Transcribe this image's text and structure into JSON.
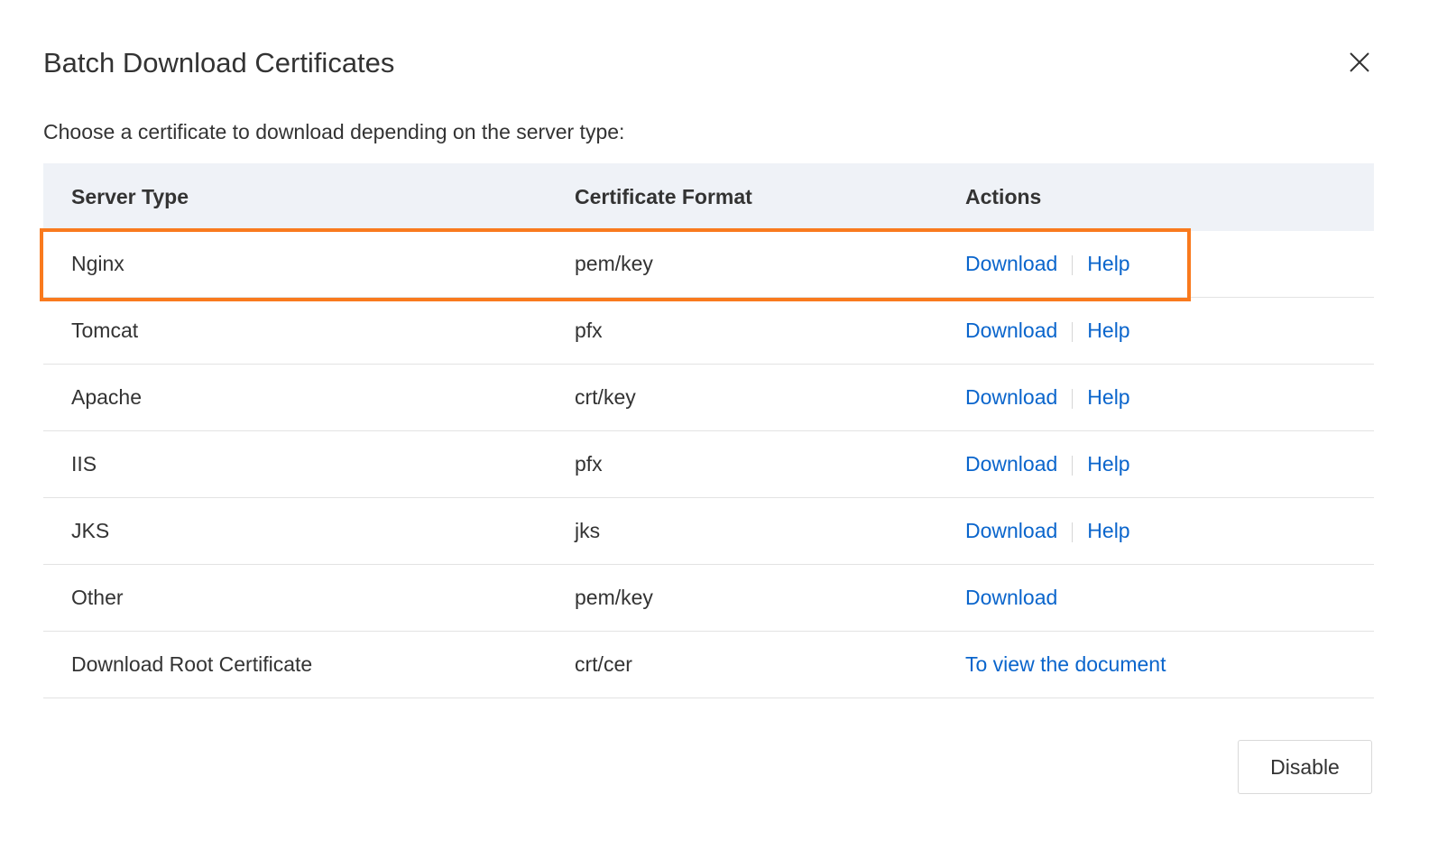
{
  "dialog": {
    "title": "Batch Download Certificates",
    "description": "Choose a certificate to download depending on the server type:",
    "close_icon": "close-icon",
    "footer_button": "Disable"
  },
  "table": {
    "headers": [
      "Server Type",
      "Certificate Format",
      "Actions"
    ],
    "rows": [
      {
        "server": "Nginx",
        "format": "pem/key",
        "download": "Download",
        "help": "Help"
      },
      {
        "server": "Tomcat",
        "format": "pfx",
        "download": "Download",
        "help": "Help"
      },
      {
        "server": "Apache",
        "format": "crt/key",
        "download": "Download",
        "help": "Help"
      },
      {
        "server": "IIS",
        "format": "pfx",
        "download": "Download",
        "help": "Help"
      },
      {
        "server": "JKS",
        "format": "jks",
        "download": "Download",
        "help": "Help"
      },
      {
        "server": "Other",
        "format": "pem/key",
        "download": "Download"
      },
      {
        "server": "Download Root Certificate",
        "format": "crt/cer",
        "link": "To view the document"
      }
    ]
  },
  "colors": {
    "accent": "#0a65cc",
    "highlight": "#f97a1e",
    "header_bg": "#eff2f7"
  }
}
